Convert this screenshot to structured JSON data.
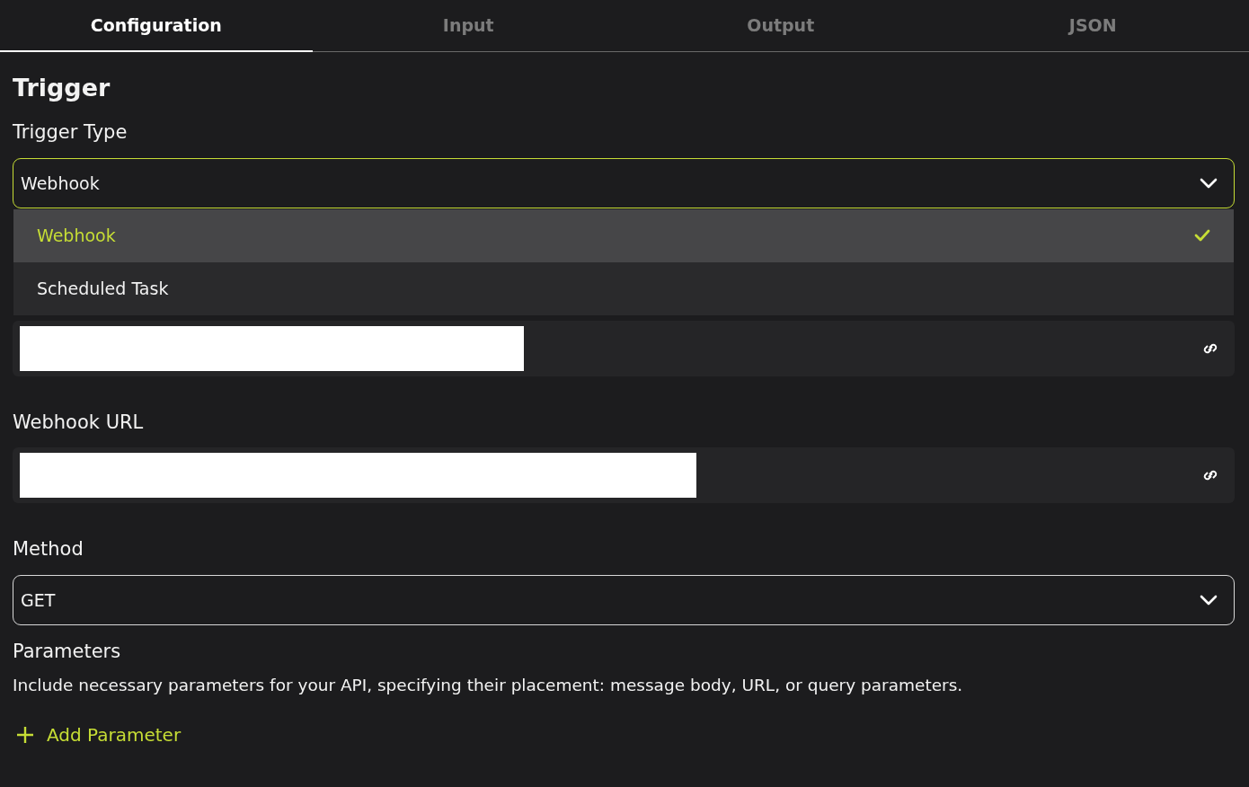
{
  "tabs": [
    {
      "label": "Configuration",
      "selected": true
    },
    {
      "label": "Input",
      "selected": false
    },
    {
      "label": "Output",
      "selected": false
    },
    {
      "label": "JSON",
      "selected": false
    }
  ],
  "section_title": "Trigger",
  "trigger_type": {
    "label": "Trigger Type",
    "value": "Webhook",
    "open": true,
    "options": [
      {
        "label": "Webhook",
        "selected": true
      },
      {
        "label": "Scheduled Task",
        "selected": false
      }
    ]
  },
  "fields": [
    {
      "redacted": true
    },
    {
      "label": "Webhook URL",
      "redacted": true
    }
  ],
  "method": {
    "label": "Method",
    "value": "GET"
  },
  "parameters": {
    "title": "Parameters",
    "description": "Include necessary parameters for your API, specifying their placement: message body, URL, or query parameters.",
    "add_label": "Add Parameter"
  }
}
